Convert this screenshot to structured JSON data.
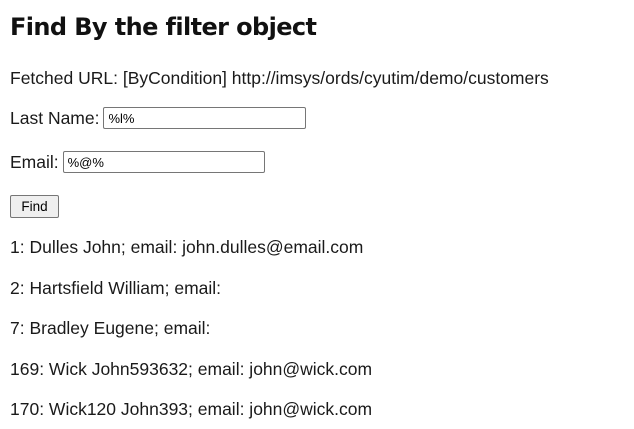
{
  "page": {
    "title": "Find By the filter object",
    "fetched_url_text": "Fetched URL: [ByCondition] http://imsys/ords/cyutim/demo/customers"
  },
  "form": {
    "last_name_label": "Last Name:",
    "last_name_value": "%l%",
    "email_label": "Email:",
    "email_value": "%@%",
    "find_button_label": "Find"
  },
  "results": [
    "1: Dulles John; email: john.dulles@email.com",
    "2: Hartsfield William; email:",
    "7: Bradley Eugene; email:",
    "169: Wick John593632; email: john@wick.com",
    "170: Wick120 John393; email: john@wick.com"
  ]
}
